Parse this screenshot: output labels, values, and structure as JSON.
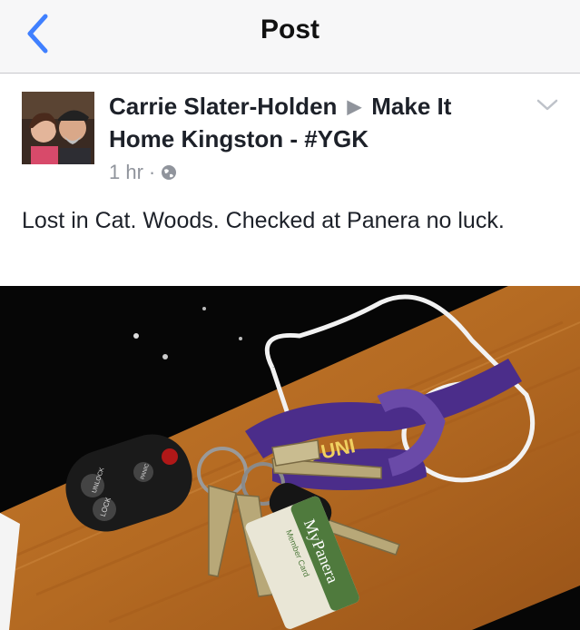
{
  "nav": {
    "title": "Post"
  },
  "post": {
    "author": "Carrie Slater-Holden",
    "group": "Make It Home Kingston  - #YGK",
    "time": "1 hr",
    "separator": "·",
    "text": "Lost in Cat. Woods. Checked at Panera no luck."
  },
  "photo": {
    "fob_labels": [
      "LOCK",
      "UNLOCK"
    ],
    "fob_panic": "PANIC",
    "lanyard_text": "'S UNI",
    "card_brand": "MyPanera",
    "card_sub": "Member Card"
  },
  "colors": {
    "accent": "#4080ff",
    "text": "#1d2129",
    "secondary": "#90949c"
  }
}
